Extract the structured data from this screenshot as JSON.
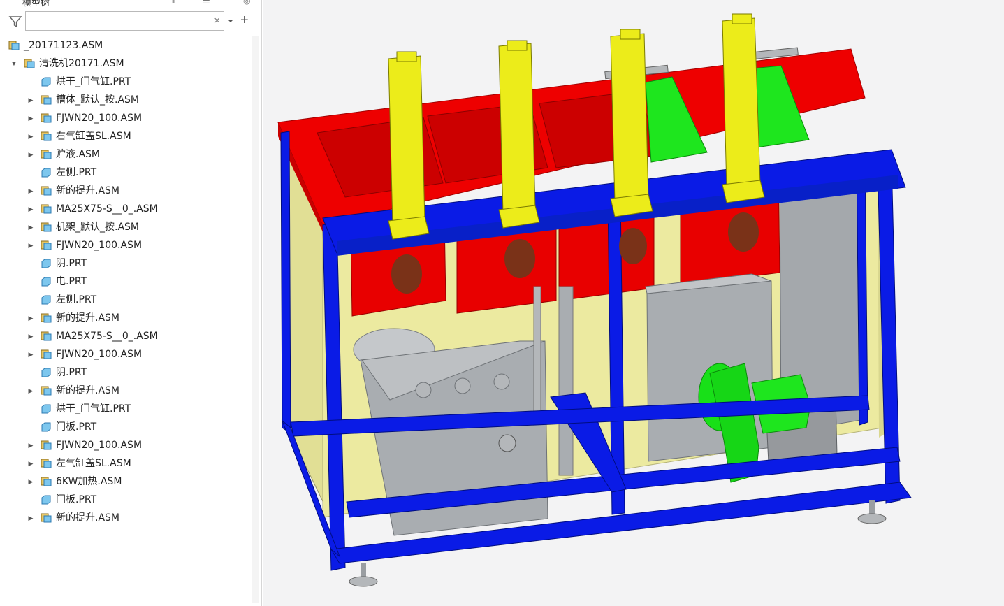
{
  "panel": {
    "title": "模型树"
  },
  "search": {
    "value": "",
    "placeholder": "",
    "clear_label": "×",
    "add_label": "+"
  },
  "tree": {
    "items": [
      {
        "label": "_20171123.ASM",
        "level": 0,
        "type": "asm",
        "expander": "none"
      },
      {
        "label": "清洗机20171.ASM",
        "level": 1,
        "type": "asm",
        "expander": "expanded"
      },
      {
        "label": "烘干_门气缸.PRT",
        "level": 2,
        "type": "prt",
        "expander": "none"
      },
      {
        "label": "槽体_默认_按.ASM",
        "level": 2,
        "type": "asm",
        "expander": "collapsed"
      },
      {
        "label": "FJWN20_100.ASM",
        "level": 2,
        "type": "asm",
        "expander": "collapsed"
      },
      {
        "label": "右气缸盖SL.ASM",
        "level": 2,
        "type": "asm",
        "expander": "collapsed"
      },
      {
        "label": "贮液.ASM",
        "level": 2,
        "type": "asm",
        "expander": "collapsed"
      },
      {
        "label": "左侧.PRT",
        "level": 2,
        "type": "prt",
        "expander": "none"
      },
      {
        "label": "新的提升.ASM",
        "level": 2,
        "type": "asm",
        "expander": "collapsed"
      },
      {
        "label": "MA25X75-S__0_.ASM",
        "level": 2,
        "type": "asm",
        "expander": "collapsed"
      },
      {
        "label": "机架_默认_按.ASM",
        "level": 2,
        "type": "asm",
        "expander": "collapsed"
      },
      {
        "label": "FJWN20_100.ASM",
        "level": 2,
        "type": "asm",
        "expander": "collapsed"
      },
      {
        "label": "阴.PRT",
        "level": 2,
        "type": "prt",
        "expander": "none"
      },
      {
        "label": "电.PRT",
        "level": 2,
        "type": "prt",
        "expander": "none"
      },
      {
        "label": "左侧.PRT",
        "level": 2,
        "type": "prt",
        "expander": "none"
      },
      {
        "label": "新的提升.ASM",
        "level": 2,
        "type": "asm",
        "expander": "collapsed"
      },
      {
        "label": "MA25X75-S__0_.ASM",
        "level": 2,
        "type": "asm",
        "expander": "collapsed"
      },
      {
        "label": "FJWN20_100.ASM",
        "level": 2,
        "type": "asm",
        "expander": "collapsed"
      },
      {
        "label": "阴.PRT",
        "level": 2,
        "type": "prt",
        "expander": "none"
      },
      {
        "label": "新的提升.ASM",
        "level": 2,
        "type": "asm",
        "expander": "collapsed"
      },
      {
        "label": "烘干_门气缸.PRT",
        "level": 2,
        "type": "prt",
        "expander": "none"
      },
      {
        "label": "门板.PRT",
        "level": 2,
        "type": "prt",
        "expander": "none"
      },
      {
        "label": "FJWN20_100.ASM",
        "level": 2,
        "type": "asm",
        "expander": "collapsed"
      },
      {
        "label": "左气缸盖SL.ASM",
        "level": 2,
        "type": "asm",
        "expander": "collapsed"
      },
      {
        "label": "6KW加热.ASM",
        "level": 2,
        "type": "asm",
        "expander": "collapsed"
      },
      {
        "label": "门板.PRT",
        "level": 2,
        "type": "prt",
        "expander": "none"
      },
      {
        "label": "新的提升.ASM",
        "level": 2,
        "type": "asm",
        "expander": "collapsed"
      }
    ]
  },
  "colors": {
    "frame": "#0a1be6",
    "tank": "#ee0000",
    "lifter": "#ecec1a",
    "lid": "#16e616",
    "panel": "#eceaa0",
    "gray": "#a9adb1",
    "asm_icon": "#e8c766",
    "prt_icon": "#7dc7ee"
  }
}
